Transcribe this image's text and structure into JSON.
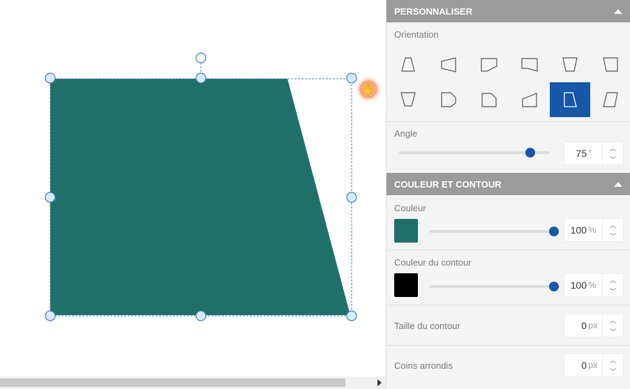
{
  "canvas": {
    "shape_color": "#20706A",
    "selection_color": "#3a7fd0"
  },
  "panel": {
    "personalize": {
      "header": "PERSONNALISER",
      "orientation_label": "Orientation",
      "orientation_options": [
        {
          "name": "trapezoid-up-icon"
        },
        {
          "name": "trapezoid-left-icon"
        },
        {
          "name": "trapezoid-down-right-icon"
        },
        {
          "name": "trapezoid-left-slant-icon"
        },
        {
          "name": "trapezoid-down-icon"
        },
        {
          "name": "trapezoid-down-left-icon"
        },
        {
          "name": "trapezoid-inverted-icon"
        },
        {
          "name": "trapezoid-right-icon"
        },
        {
          "name": "trapezoid-top-right-icon"
        },
        {
          "name": "trapezoid-top-left-icon"
        },
        {
          "name": "trapezoid-right-slant-icon",
          "active": true
        },
        {
          "name": "parallelogram-icon"
        }
      ],
      "angle_label": "Angle",
      "angle_value": "75",
      "angle_unit": "°",
      "angle_fraction": 0.87
    },
    "color_outline": {
      "header": "COULEUR ET CONTOUR",
      "color_label": "Couleur",
      "color_swatch": "#20706A",
      "color_opacity": "100",
      "color_opacity_unit": "%",
      "outline_color_label": "Couleur du contour",
      "outline_swatch": "#000000",
      "outline_opacity": "100",
      "outline_opacity_unit": "%",
      "outline_size_label": "Taille du contour",
      "outline_size_value": "0",
      "outline_size_unit": "px",
      "rounded_corners_label": "Coins arrondis",
      "rounded_corners_value": "0",
      "rounded_corners_unit": "px"
    },
    "accent_color": "#1858A8"
  }
}
